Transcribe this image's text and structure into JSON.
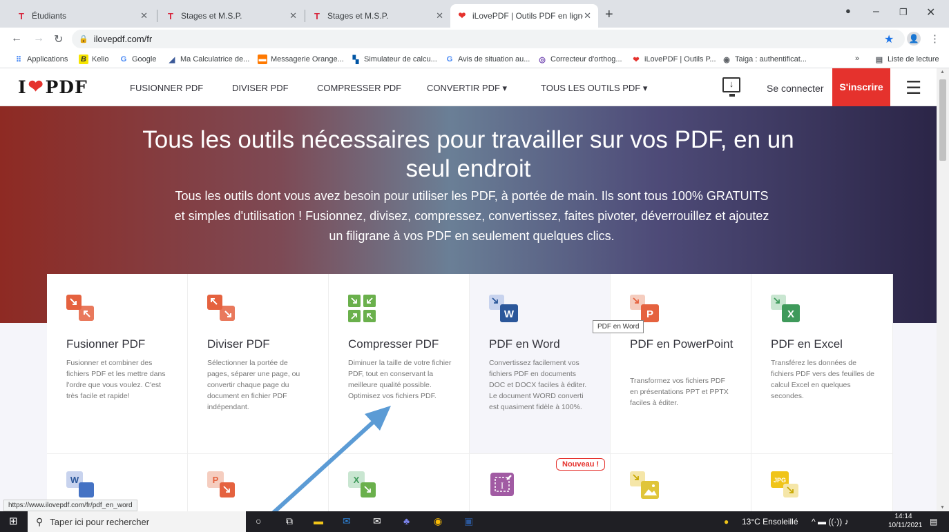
{
  "browser": {
    "tabs": [
      {
        "label": "Étudiants"
      },
      {
        "label": "Stages et M.S.P."
      },
      {
        "label": "Stages et M.S.P."
      },
      {
        "label": "iLovePDF | Outils PDF en ligne po"
      }
    ],
    "url": "ilovepdf.com/fr",
    "bookmarks": [
      "Applications",
      "Kelio",
      "Google",
      "Ma Calculatrice de...",
      "Messagerie Orange...",
      "Simulateur de calcu...",
      "Avis de situation au...",
      "Correcteur d'orthog...",
      "iLovePDF | Outils P...",
      "Taiga : authentificat..."
    ],
    "reading_list": "Liste de lecture",
    "more_bookmarks": "»"
  },
  "site": {
    "logo_left": "I",
    "logo_right": "PDF",
    "menu": [
      "FUSIONNER PDF",
      "DIVISER PDF",
      "COMPRESSER PDF",
      "CONVERTIR PDF ▾",
      "TOUS LES OUTILS PDF ▾"
    ],
    "login": "Se connecter",
    "signup": "S'inscrire",
    "hero_title": "Tous les outils nécessaires pour travailler sur vos PDF, en un seul endroit",
    "hero_text": "Tous les outils dont vous avez besoin pour utiliser les PDF, à portée de main. Ils sont tous 100% GRATUITS et simples d'utilisation ! Fusionnez, divisez, compressez, convertissez, faites pivoter, déverrouillez et ajoutez un filigrane à vos PDF en seulement quelques clics.",
    "tools": [
      {
        "title": "Fusionner PDF",
        "desc": "Fusionner et combiner des fichiers PDF et les mettre dans l'ordre que vous voulez. C'est très facile et rapide!",
        "color": "#e5623f"
      },
      {
        "title": "Diviser PDF",
        "desc": "Sélectionner la portée de pages, séparer une page, ou convertir chaque page du document en fichier PDF indépendant.",
        "color": "#e5623f"
      },
      {
        "title": "Compresser PDF",
        "desc": "Diminuer la taille de votre fichier PDF, tout en conservant la meilleure qualité possible. Optimisez vos fichiers PDF.",
        "color": "#6ab04c"
      },
      {
        "title": "PDF en Word",
        "desc": "Convertissez facilement vos fichiers PDF en documents DOC et DOCX faciles à éditer. Le document WORD converti est quasiment fidèle à 100%.",
        "color": "#2b579a"
      },
      {
        "title": "PDF en PowerPoint",
        "desc": "Transformez vos fichiers PDF en présentations PPT et PPTX faciles à éditer.",
        "color": "#e5623f"
      },
      {
        "title": "PDF en Excel",
        "desc": "Transférez les données de fichiers PDF vers des feuilles de calcul Excel en quelques secondes.",
        "color": "#3f9a5b"
      }
    ],
    "row2_letters": [
      "W",
      "P",
      "X",
      "",
      "",
      "JPG"
    ],
    "badge_new": "Nouveau !",
    "tooltip": "PDF en Word",
    "status_url": "https://www.ilovepdf.com/fr/pdf_en_word"
  },
  "taskbar": {
    "search_placeholder": "Taper ici pour rechercher",
    "weather": "13°C Ensoleillé",
    "time": "14:14",
    "date": "10/11/2021"
  }
}
